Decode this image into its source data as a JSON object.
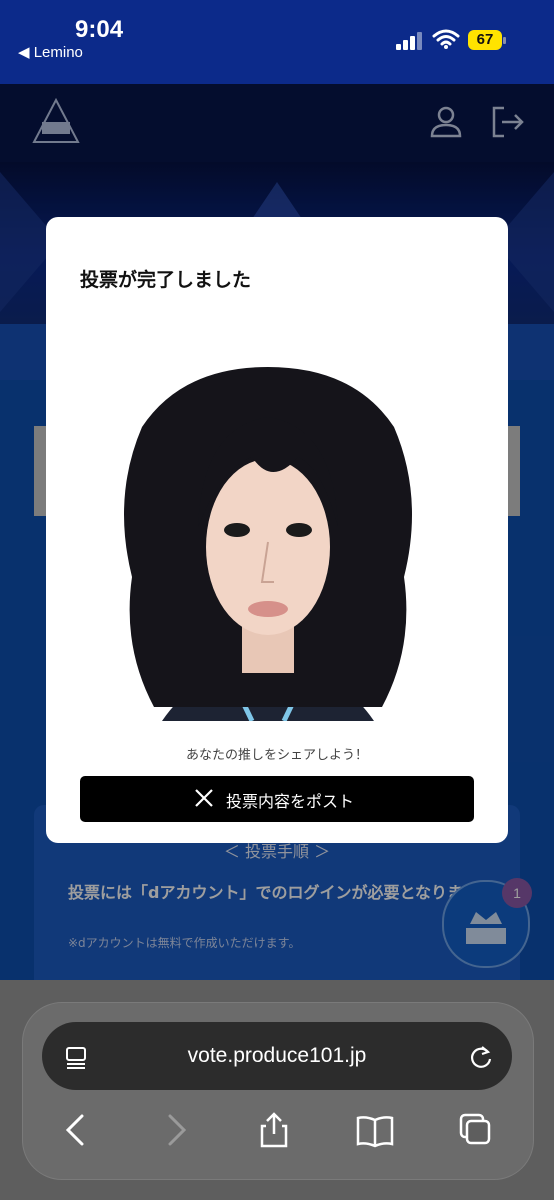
{
  "status_bar": {
    "time": "9:04",
    "back_app": "◀ Lemino",
    "battery": "67"
  },
  "modal": {
    "title": "投票が完了しました",
    "share_caption": "あなたの推しをシェアしよう！",
    "post_button_label": "投票内容をポスト"
  },
  "page": {
    "steps_title": "＜ 投票手順 ＞",
    "steps_text": "投票には「dアカウント」でのログインが必要となります。",
    "steps_note": "※dアカウントは無料で作成いただけます。",
    "fab_badge": "1"
  },
  "browser": {
    "url": "vote.produce101.jp"
  },
  "colors": {
    "accent": "#0c2a8a",
    "button": "#000000",
    "page_bg": "#0e4fb0"
  },
  "icons": [
    "user-icon",
    "logout-icon",
    "x-logo-icon",
    "reader-icon",
    "reload-icon",
    "back-icon",
    "forward-icon",
    "share-icon",
    "bookmarks-icon",
    "tabs-icon"
  ]
}
